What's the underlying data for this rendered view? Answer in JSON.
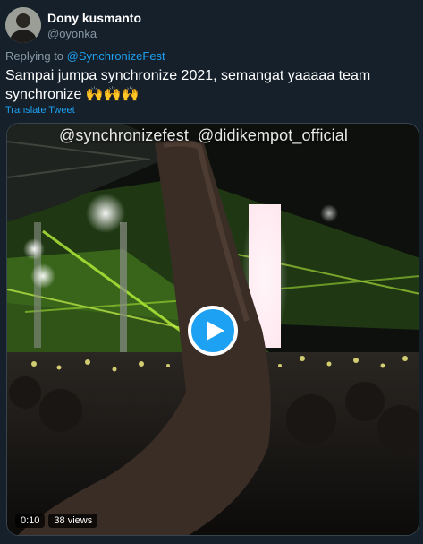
{
  "author": {
    "name": "Dony kusmanto",
    "handle": "@oyonka"
  },
  "reply": {
    "prefix": "Replying to ",
    "mention": "@SynchronizeFest"
  },
  "tweet_text": "Sampai jumpa synchronize 2021, semangat yaaaaa team synchronize 🙌🙌🙌",
  "translate_label": "Translate Tweet",
  "video": {
    "overlay_tag_1": "@synchronizefest",
    "overlay_tag_2": "@didikempot_official",
    "time": "0:10",
    "views": "38 views"
  },
  "colors": {
    "background": "#15202b",
    "link": "#1da1f2",
    "secondary_text": "#8899a6"
  }
}
